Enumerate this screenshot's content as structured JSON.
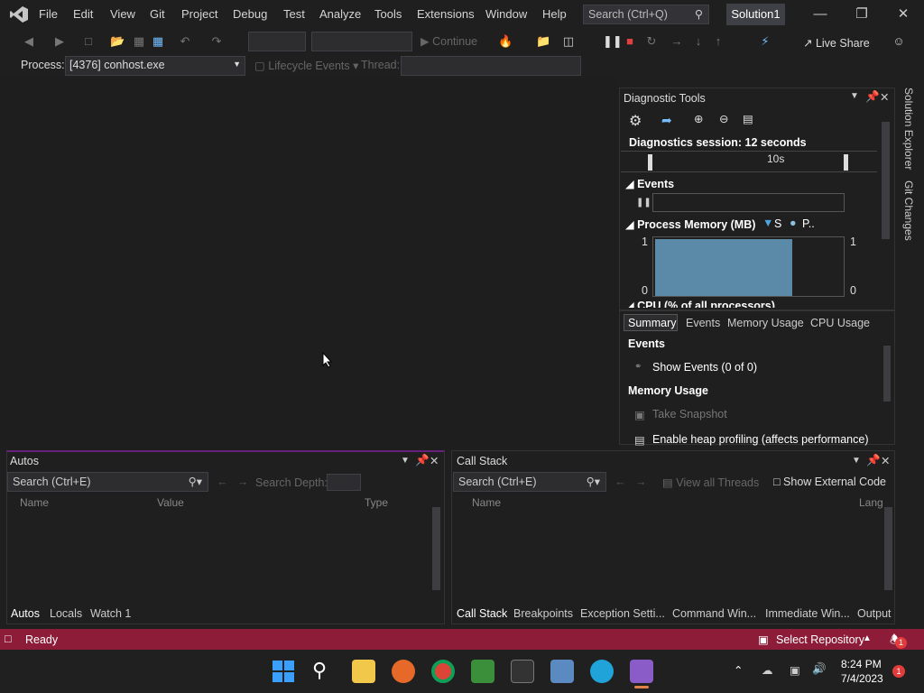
{
  "menu": {
    "items": [
      "File",
      "Edit",
      "View",
      "Git",
      "Project",
      "Debug",
      "Test",
      "Analyze",
      "Tools",
      "Extensions",
      "Window",
      "Help"
    ],
    "search_placeholder": "Search (Ctrl+Q)",
    "solution": "Solution1"
  },
  "toolbar": {
    "continue_label": "Continue",
    "live_share_label": "Live Share"
  },
  "debug_location": {
    "process_label": "Process:",
    "process_value": "[4376] conhost.exe",
    "lifecycle_label": "Lifecycle Events",
    "thread_label": "Thread:"
  },
  "diagnostics": {
    "title": "Diagnostic Tools",
    "session": "Diagnostics session: 12 seconds",
    "timeline_tick": "10s",
    "events_header": "Events",
    "memory_header": "Process Memory (MB)",
    "legend_s": "S",
    "legend_p": "P..",
    "memory_axis": {
      "top_left": "1",
      "bottom_left": "0",
      "top_right": "1",
      "bottom_right": "0"
    },
    "memory_fill_fraction": 0.62,
    "cpu_header": "CPU (% of all processors)",
    "tabs": [
      "Summary",
      "Events",
      "Memory Usage",
      "CPU Usage"
    ],
    "summary_events_title": "Events",
    "show_events": "Show Events (0 of 0)",
    "memory_usage_title": "Memory Usage",
    "take_snapshot": "Take Snapshot",
    "enable_heap": "Enable heap profiling (affects performance)"
  },
  "right_sidebar": {
    "solution_explorer": "Solution Explorer",
    "git_changes": "Git Changes"
  },
  "autos": {
    "title": "Autos",
    "search_placeholder": "Search (Ctrl+E)",
    "search_depth": "Search Depth:",
    "columns": [
      "Name",
      "Value",
      "Type"
    ],
    "tabs": [
      "Autos",
      "Locals",
      "Watch 1"
    ]
  },
  "callstack": {
    "title": "Call Stack",
    "search_placeholder": "Search (Ctrl+E)",
    "view_all_threads": "View all Threads",
    "show_external": "Show External Code",
    "columns": [
      "Name",
      "Lang"
    ],
    "tabs": [
      "Call Stack",
      "Breakpoints",
      "Exception Setti...",
      "Command Win...",
      "Immediate Win...",
      "Output"
    ]
  },
  "status": {
    "ready": "Ready",
    "select_repo": "Select Repository",
    "notifications": "1"
  },
  "taskbar": {
    "time": "8:24 PM",
    "date": "7/4/2023",
    "badge": "1"
  },
  "colors": {
    "accent_purple": "#68217a",
    "status_bar": "#8c1c38",
    "memory_fill": "#5a8aa8"
  }
}
